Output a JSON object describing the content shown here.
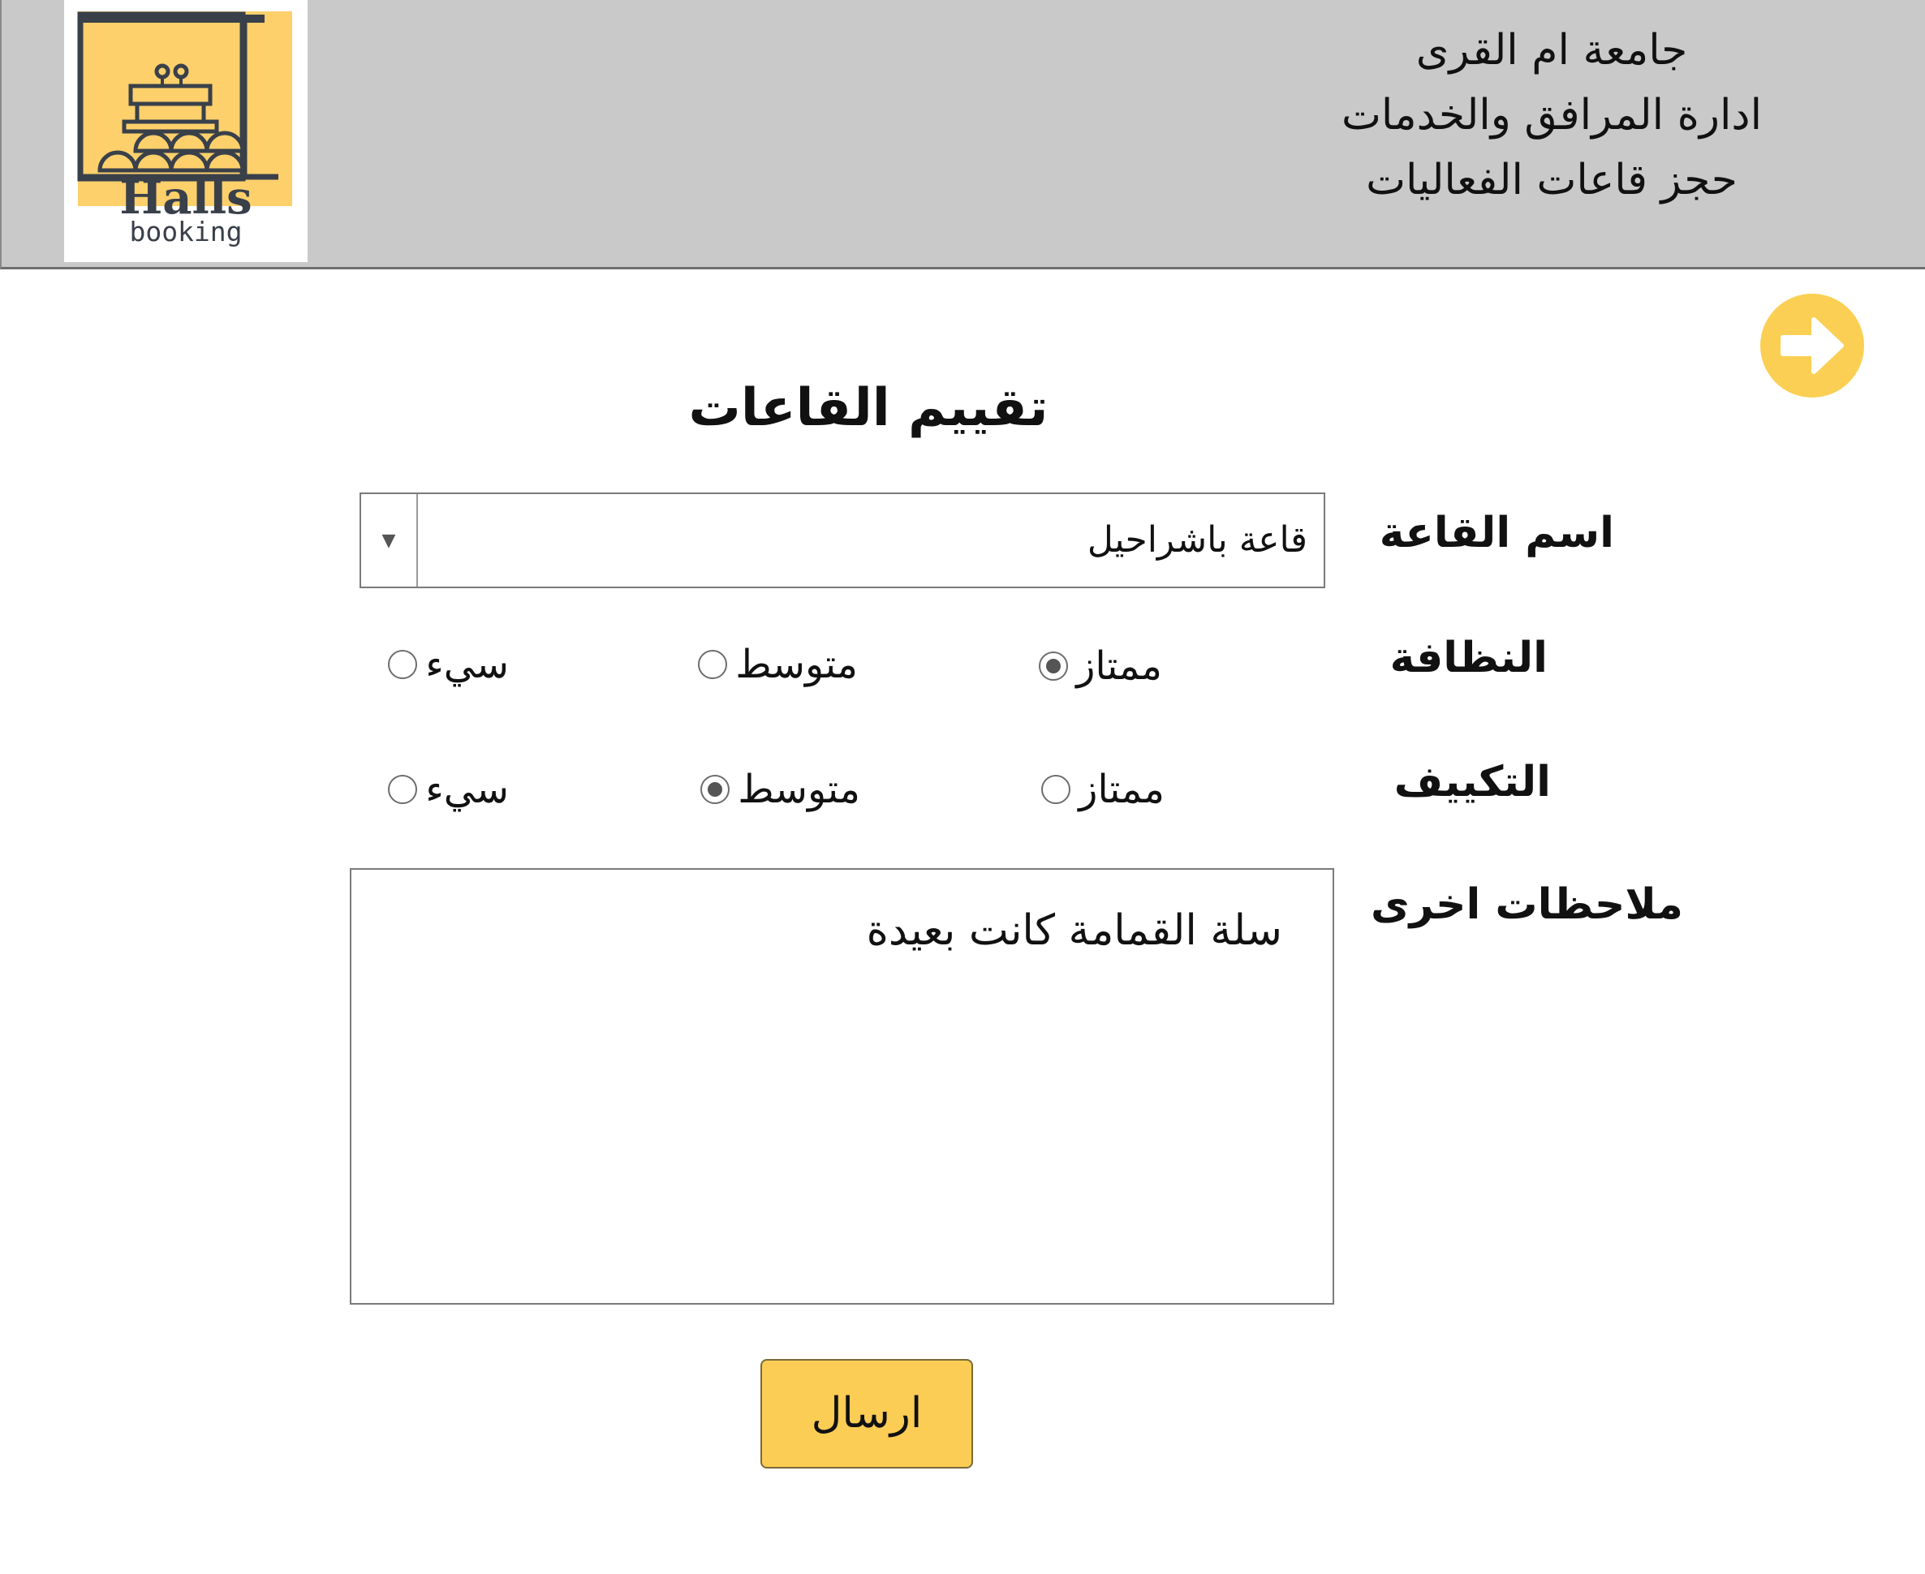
{
  "header": {
    "org_line_1": "جامعة ام القرى",
    "org_line_2": "ادارة المرافق والخدمات",
    "org_line_3": "حجز قاعات الفعاليات",
    "logo_title": "Halls",
    "logo_subtitle": "booking",
    "logo_accent_color": "#fdd06b"
  },
  "back_button": {
    "icon": "arrow-right-circle-icon",
    "color": "#fbcf53"
  },
  "form": {
    "title": "تقييم القاعات",
    "hall": {
      "label": "اسم القاعة",
      "selected": "قاعة باشراحيل",
      "arrow_glyph": "▼"
    },
    "cleanliness": {
      "label": "النظافة",
      "options": [
        {
          "label": "ممتاز",
          "checked": true
        },
        {
          "label": "متوسط",
          "checked": false
        },
        {
          "label": "سيء",
          "checked": false
        }
      ]
    },
    "ac": {
      "label": "التكييف",
      "options": [
        {
          "label": "ممتاز",
          "checked": false
        },
        {
          "label": "متوسط",
          "checked": true
        },
        {
          "label": "سيء",
          "checked": false
        }
      ]
    },
    "notes": {
      "label": "ملاحظات اخرى",
      "value": "سلة القمامة كانت بعيدة"
    },
    "submit_label": "ارسال"
  }
}
